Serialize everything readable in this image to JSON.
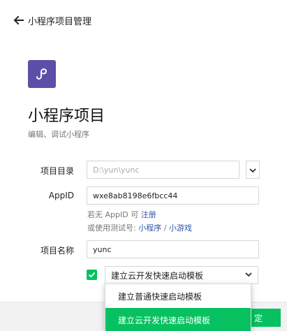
{
  "header": {
    "title": "小程序项目管理",
    "back_icon": "arrow-left-icon"
  },
  "project": {
    "logo_icon": "miniprogram-logo-icon",
    "logo_color": "#5b4fa8",
    "title": "小程序项目",
    "subtitle": "编辑、调试小程序"
  },
  "form": {
    "directory": {
      "label": "项目目录",
      "placeholder": "D:\\yun\\yunc"
    },
    "appid": {
      "label": "AppID",
      "value": "wxe8ab8198e6fbcc44"
    },
    "hint1": {
      "prefix": "若无 AppID 可 ",
      "link": "注册"
    },
    "hint2": {
      "prefix": "或使用测试号: ",
      "link1": "小程序",
      "sep": " / ",
      "link2": "小游戏"
    },
    "name": {
      "label": "项目名称",
      "value": "yunc"
    },
    "template": {
      "checked": true,
      "selected": "建立云开发快速启动模板",
      "options": [
        "建立普通快速启动模板",
        "建立云开发快速启动模板"
      ]
    }
  },
  "footer": {
    "confirm_label": "定"
  },
  "colors": {
    "accent": "#07c160",
    "link": "#2f55a8"
  }
}
